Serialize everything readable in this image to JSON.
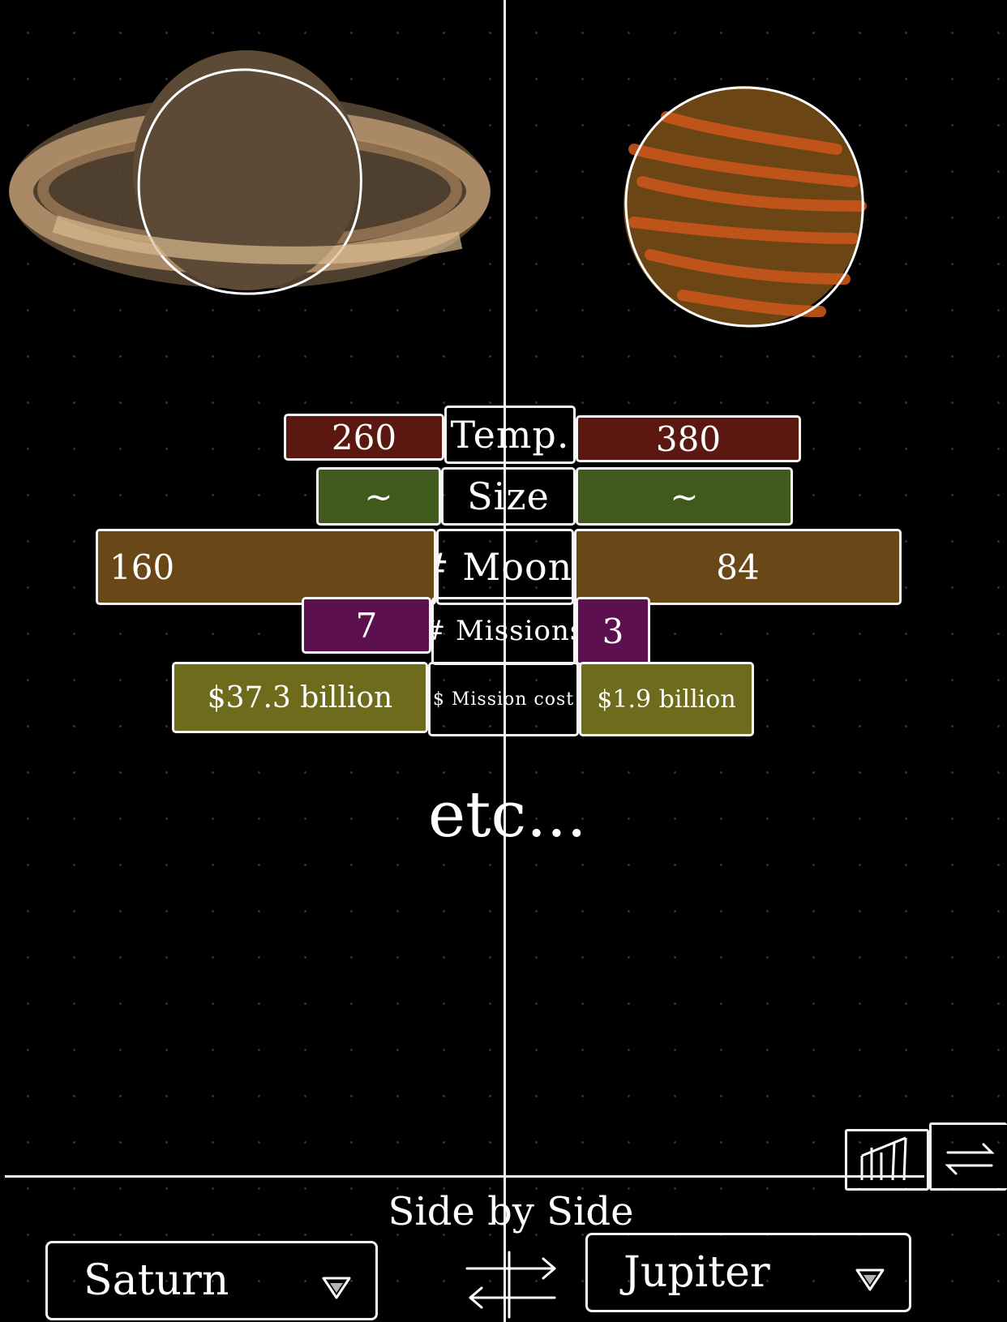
{
  "planets": {
    "left": {
      "name": "Saturn",
      "icon": "saturn-icon",
      "color": "#5c4a36",
      "ring_color": "#c9a47a"
    },
    "right": {
      "name": "Jupiter",
      "icon": "jupiter-icon",
      "color": "#6b4513",
      "stripe_color": "#c8561b"
    }
  },
  "comparison": {
    "rows": [
      {
        "label": "Temp.",
        "left": "260",
        "right": "380",
        "color": "#5a1810"
      },
      {
        "label": "Size",
        "left": "~",
        "right": "~",
        "color": "#3f5a1c"
      },
      {
        "label": "# Moons",
        "left": "160",
        "right": "84",
        "color": "#6a4716"
      },
      {
        "label": "# Missions",
        "left": "7",
        "right": "3",
        "color": "#5c1050"
      },
      {
        "label": "$ Mission cost",
        "left": "$37.3 billion",
        "right": "$1.9 billion",
        "color": "#6e6b1d"
      }
    ],
    "more": "etc..."
  },
  "footer": {
    "mode_title": "Side by Side",
    "left_select": "Saturn",
    "right_select": "Jupiter",
    "swap_icon": "swap-arrows-icon",
    "dropdown_icon": "chevron-down-icon",
    "toolbar_icons": [
      "chart-icon",
      "swap-view-icon"
    ]
  }
}
